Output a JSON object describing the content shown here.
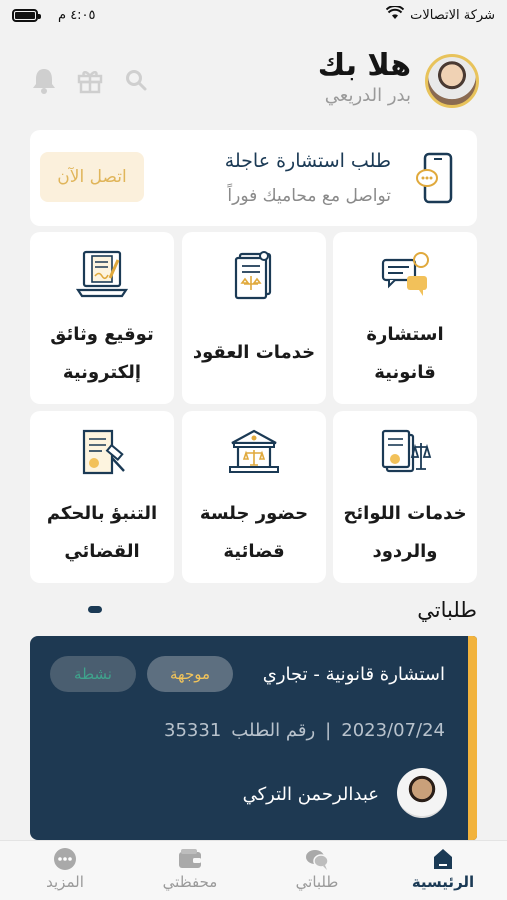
{
  "status_bar": {
    "carrier": "شركة الاتصالات",
    "time": "٤:٠٥ م"
  },
  "header": {
    "greeting": "هلا بك",
    "user_name": "بدر الدريعي"
  },
  "urgent": {
    "title": "طلب استشارة عاجلة",
    "subtitle": "تواصل مع محاميك فوراً",
    "call_label": "اتصل الآن"
  },
  "services": [
    {
      "label": "استشارة قانونية",
      "icon": "consultation-chat-icon"
    },
    {
      "label": "خدمات العقود",
      "icon": "contract-document-icon"
    },
    {
      "label": "توقيع وثائق إلكترونية",
      "icon": "e-signature-laptop-icon"
    },
    {
      "label": "خدمات اللوائح والردود",
      "icon": "regulations-scale-icon"
    },
    {
      "label": "حضور جلسة قضائية",
      "icon": "courthouse-icon"
    },
    {
      "label": "التنبؤ بالحكم القضائي",
      "icon": "gavel-document-icon"
    }
  ],
  "my_requests": {
    "title": "طلباتي",
    "request": {
      "type": "استشارة قانونية - تجاري",
      "status_directed": "موجهة",
      "status_active": "نشطة",
      "date": "2023/07/24",
      "separator": "|",
      "number_label": "رقم الطلب",
      "number": "35331",
      "lawyer_name": "عبدالرحمن التركي"
    }
  },
  "tabs": [
    {
      "label": "الرئيسية",
      "icon": "home-icon"
    },
    {
      "label": "طلباتي",
      "icon": "requests-chat-icon"
    },
    {
      "label": "محفظتي",
      "icon": "wallet-icon"
    },
    {
      "label": "المزيد",
      "icon": "more-icon"
    }
  ],
  "colors": {
    "navy": "#1e3952",
    "gold": "#f2b33d",
    "accent_text": "#1b3a55"
  }
}
